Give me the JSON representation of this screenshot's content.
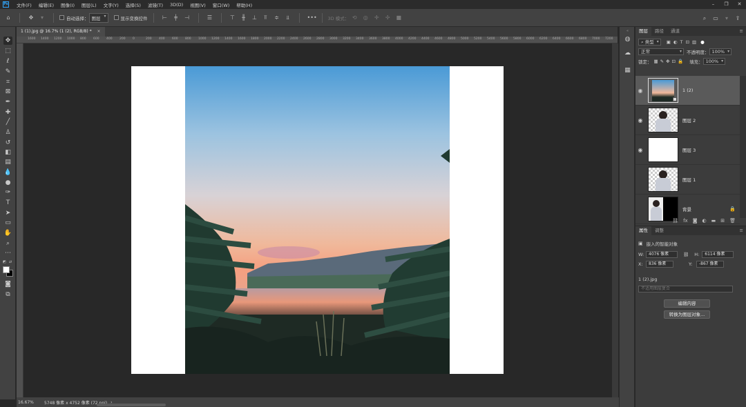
{
  "menubar": {
    "items": [
      "文件(F)",
      "编辑(E)",
      "图像(I)",
      "图层(L)",
      "文字(Y)",
      "选择(S)",
      "滤镜(T)",
      "3D(D)",
      "视图(V)",
      "窗口(W)",
      "帮助(H)"
    ]
  },
  "options": {
    "auto_select_label": "自动选择：",
    "auto_select_value": "图层",
    "show_transform_label": "显示变换控件",
    "mode_3d_label": "3D 模式："
  },
  "document": {
    "tab_title": "1 (1).jpg @ 16.7% (1 (2), RGB/8) *",
    "ruler_ticks": [
      "1600",
      "1400",
      "1200",
      "1000",
      "800",
      "600",
      "400",
      "200",
      "0",
      "200",
      "400",
      "600",
      "800",
      "1000",
      "1200",
      "1400",
      "1600",
      "1800",
      "2000",
      "2200",
      "2400",
      "2600",
      "2800",
      "3000",
      "3200",
      "3400",
      "3600",
      "3800",
      "4000",
      "4200",
      "4400",
      "4600",
      "4800",
      "5000",
      "5200",
      "5400",
      "5600",
      "5800",
      "6000",
      "6200",
      "6400",
      "6600",
      "6800",
      "7000",
      "7200"
    ]
  },
  "status": {
    "zoom": "16.67%",
    "doc_info": "5748 像素 x 4752 像素 (72 ppi)",
    "arrow": "›"
  },
  "layers_panel": {
    "tabs": [
      "图层",
      "路径",
      "通道"
    ],
    "filter_kind": "类型",
    "blend_mode": "正常",
    "opacity_label": "不透明度：",
    "opacity_value": "100%",
    "lock_label": "锁定：",
    "fill_label": "填充：",
    "fill_value": "100%",
    "layers": [
      {
        "name": "1 (2)",
        "visible": true,
        "selected": true,
        "thumb": "landscape"
      },
      {
        "name": "图层 2",
        "visible": true,
        "selected": false,
        "thumb": "person-transparent"
      },
      {
        "name": "图层 3",
        "visible": true,
        "selected": false,
        "thumb": "white"
      },
      {
        "name": "图层 1",
        "visible": false,
        "selected": false,
        "thumb": "person-transparent"
      },
      {
        "name": "背景",
        "visible": false,
        "selected": false,
        "thumb": "person-black"
      }
    ]
  },
  "properties_panel": {
    "tabs": [
      "属性",
      "调整"
    ],
    "smart_object_label": "嵌入的智能对象",
    "w_label": "W:",
    "w_value": "4076 像素",
    "h_label": "H:",
    "h_value": "6114 像素",
    "x_label": "X:",
    "x_value": "836 像素",
    "y_label": "Y:",
    "y_value": "-867 像素",
    "source_file": "1 (2).jpg",
    "comps_placeholder": "不适用图层复合",
    "edit_button": "编辑内容",
    "convert_button": "转换为图层对象..."
  },
  "colors": {
    "accent": "#31a8ff",
    "panel": "#3c3c3c",
    "canvas": "#282828",
    "selected_layer": "#5a5a5a"
  }
}
